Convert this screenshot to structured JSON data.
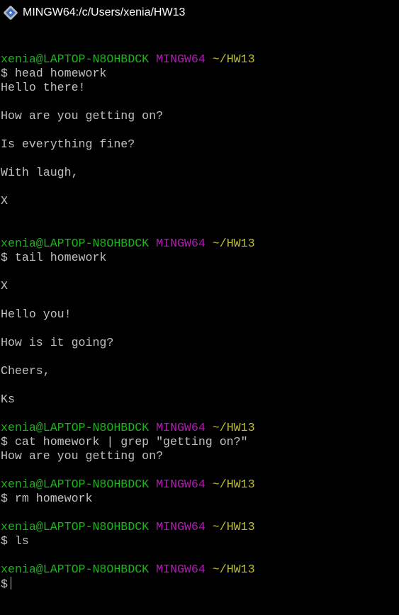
{
  "window": {
    "title": "MINGW64:/c/Users/xenia/HW13",
    "icon": "git-bash-icon"
  },
  "colors": {
    "background": "#000000",
    "user": "#1fb11f",
    "system": "#b31ab3",
    "path": "#c0c01e",
    "text": "#c0c0c0"
  },
  "terminal": {
    "lines": [
      {
        "type": "blank"
      },
      {
        "type": "prompt",
        "user": "xenia@LAPTOP-N8OHBDCK",
        "system": "MINGW64",
        "path": "~/HW13"
      },
      {
        "type": "text",
        "text": "$ head homework"
      },
      {
        "type": "text",
        "text": "Hello there!"
      },
      {
        "type": "blank"
      },
      {
        "type": "text",
        "text": "How are you getting on?"
      },
      {
        "type": "blank"
      },
      {
        "type": "text",
        "text": "Is everything fine?"
      },
      {
        "type": "blank"
      },
      {
        "type": "text",
        "text": "With laugh,"
      },
      {
        "type": "blank"
      },
      {
        "type": "text",
        "text": "X"
      },
      {
        "type": "blank"
      },
      {
        "type": "blank"
      },
      {
        "type": "prompt",
        "user": "xenia@LAPTOP-N8OHBDCK",
        "system": "MINGW64",
        "path": "~/HW13"
      },
      {
        "type": "text",
        "text": "$ tail homework"
      },
      {
        "type": "blank"
      },
      {
        "type": "text",
        "text": "X"
      },
      {
        "type": "blank"
      },
      {
        "type": "text",
        "text": "Hello you!"
      },
      {
        "type": "blank"
      },
      {
        "type": "text",
        "text": "How is it going?"
      },
      {
        "type": "blank"
      },
      {
        "type": "text",
        "text": "Cheers,"
      },
      {
        "type": "blank"
      },
      {
        "type": "text",
        "text": "Ks"
      },
      {
        "type": "blank"
      },
      {
        "type": "prompt",
        "user": "xenia@LAPTOP-N8OHBDCK",
        "system": "MINGW64",
        "path": "~/HW13"
      },
      {
        "type": "text",
        "text": "$ cat homework | grep \"getting on?\""
      },
      {
        "type": "text",
        "text": "How are you getting on?"
      },
      {
        "type": "blank"
      },
      {
        "type": "prompt",
        "user": "xenia@LAPTOP-N8OHBDCK",
        "system": "MINGW64",
        "path": "~/HW13"
      },
      {
        "type": "text",
        "text": "$ rm homework"
      },
      {
        "type": "blank"
      },
      {
        "type": "prompt",
        "user": "xenia@LAPTOP-N8OHBDCK",
        "system": "MINGW64",
        "path": "~/HW13"
      },
      {
        "type": "text",
        "text": "$ ls"
      },
      {
        "type": "blank"
      },
      {
        "type": "prompt",
        "user": "xenia@LAPTOP-N8OHBDCK",
        "system": "MINGW64",
        "path": "~/HW13"
      },
      {
        "type": "input",
        "text": "$"
      }
    ]
  }
}
